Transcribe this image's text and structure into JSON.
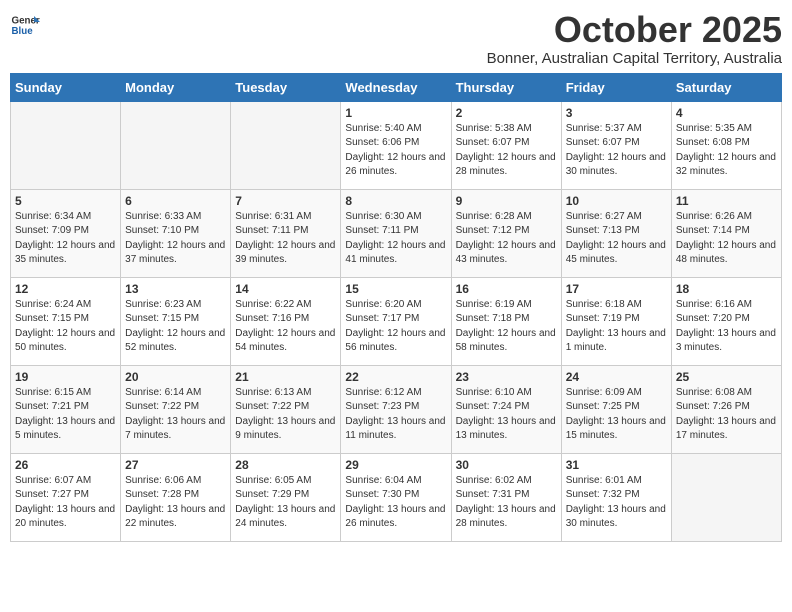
{
  "header": {
    "logo_line1": "General",
    "logo_line2": "Blue",
    "month_year": "October 2025",
    "location": "Bonner, Australian Capital Territory, Australia"
  },
  "days_of_week": [
    "Sunday",
    "Monday",
    "Tuesday",
    "Wednesday",
    "Thursday",
    "Friday",
    "Saturday"
  ],
  "weeks": [
    [
      {
        "day": "",
        "empty": true
      },
      {
        "day": "",
        "empty": true
      },
      {
        "day": "",
        "empty": true
      },
      {
        "day": "1",
        "sunrise": "5:40 AM",
        "sunset": "6:06 PM",
        "daylight": "12 hours and 26 minutes."
      },
      {
        "day": "2",
        "sunrise": "5:38 AM",
        "sunset": "6:07 PM",
        "daylight": "12 hours and 28 minutes."
      },
      {
        "day": "3",
        "sunrise": "5:37 AM",
        "sunset": "6:07 PM",
        "daylight": "12 hours and 30 minutes."
      },
      {
        "day": "4",
        "sunrise": "5:35 AM",
        "sunset": "6:08 PM",
        "daylight": "12 hours and 32 minutes."
      }
    ],
    [
      {
        "day": "5",
        "sunrise": "6:34 AM",
        "sunset": "7:09 PM",
        "daylight": "12 hours and 35 minutes."
      },
      {
        "day": "6",
        "sunrise": "6:33 AM",
        "sunset": "7:10 PM",
        "daylight": "12 hours and 37 minutes."
      },
      {
        "day": "7",
        "sunrise": "6:31 AM",
        "sunset": "7:11 PM",
        "daylight": "12 hours and 39 minutes."
      },
      {
        "day": "8",
        "sunrise": "6:30 AM",
        "sunset": "7:11 PM",
        "daylight": "12 hours and 41 minutes."
      },
      {
        "day": "9",
        "sunrise": "6:28 AM",
        "sunset": "7:12 PM",
        "daylight": "12 hours and 43 minutes."
      },
      {
        "day": "10",
        "sunrise": "6:27 AM",
        "sunset": "7:13 PM",
        "daylight": "12 hours and 45 minutes."
      },
      {
        "day": "11",
        "sunrise": "6:26 AM",
        "sunset": "7:14 PM",
        "daylight": "12 hours and 48 minutes."
      }
    ],
    [
      {
        "day": "12",
        "sunrise": "6:24 AM",
        "sunset": "7:15 PM",
        "daylight": "12 hours and 50 minutes."
      },
      {
        "day": "13",
        "sunrise": "6:23 AM",
        "sunset": "7:15 PM",
        "daylight": "12 hours and 52 minutes."
      },
      {
        "day": "14",
        "sunrise": "6:22 AM",
        "sunset": "7:16 PM",
        "daylight": "12 hours and 54 minutes."
      },
      {
        "day": "15",
        "sunrise": "6:20 AM",
        "sunset": "7:17 PM",
        "daylight": "12 hours and 56 minutes."
      },
      {
        "day": "16",
        "sunrise": "6:19 AM",
        "sunset": "7:18 PM",
        "daylight": "12 hours and 58 minutes."
      },
      {
        "day": "17",
        "sunrise": "6:18 AM",
        "sunset": "7:19 PM",
        "daylight": "13 hours and 1 minute."
      },
      {
        "day": "18",
        "sunrise": "6:16 AM",
        "sunset": "7:20 PM",
        "daylight": "13 hours and 3 minutes."
      }
    ],
    [
      {
        "day": "19",
        "sunrise": "6:15 AM",
        "sunset": "7:21 PM",
        "daylight": "13 hours and 5 minutes."
      },
      {
        "day": "20",
        "sunrise": "6:14 AM",
        "sunset": "7:22 PM",
        "daylight": "13 hours and 7 minutes."
      },
      {
        "day": "21",
        "sunrise": "6:13 AM",
        "sunset": "7:22 PM",
        "daylight": "13 hours and 9 minutes."
      },
      {
        "day": "22",
        "sunrise": "6:12 AM",
        "sunset": "7:23 PM",
        "daylight": "13 hours and 11 minutes."
      },
      {
        "day": "23",
        "sunrise": "6:10 AM",
        "sunset": "7:24 PM",
        "daylight": "13 hours and 13 minutes."
      },
      {
        "day": "24",
        "sunrise": "6:09 AM",
        "sunset": "7:25 PM",
        "daylight": "13 hours and 15 minutes."
      },
      {
        "day": "25",
        "sunrise": "6:08 AM",
        "sunset": "7:26 PM",
        "daylight": "13 hours and 17 minutes."
      }
    ],
    [
      {
        "day": "26",
        "sunrise": "6:07 AM",
        "sunset": "7:27 PM",
        "daylight": "13 hours and 20 minutes."
      },
      {
        "day": "27",
        "sunrise": "6:06 AM",
        "sunset": "7:28 PM",
        "daylight": "13 hours and 22 minutes."
      },
      {
        "day": "28",
        "sunrise": "6:05 AM",
        "sunset": "7:29 PM",
        "daylight": "13 hours and 24 minutes."
      },
      {
        "day": "29",
        "sunrise": "6:04 AM",
        "sunset": "7:30 PM",
        "daylight": "13 hours and 26 minutes."
      },
      {
        "day": "30",
        "sunrise": "6:02 AM",
        "sunset": "7:31 PM",
        "daylight": "13 hours and 28 minutes."
      },
      {
        "day": "31",
        "sunrise": "6:01 AM",
        "sunset": "7:32 PM",
        "daylight": "13 hours and 30 minutes."
      },
      {
        "day": "",
        "empty": true
      }
    ]
  ]
}
